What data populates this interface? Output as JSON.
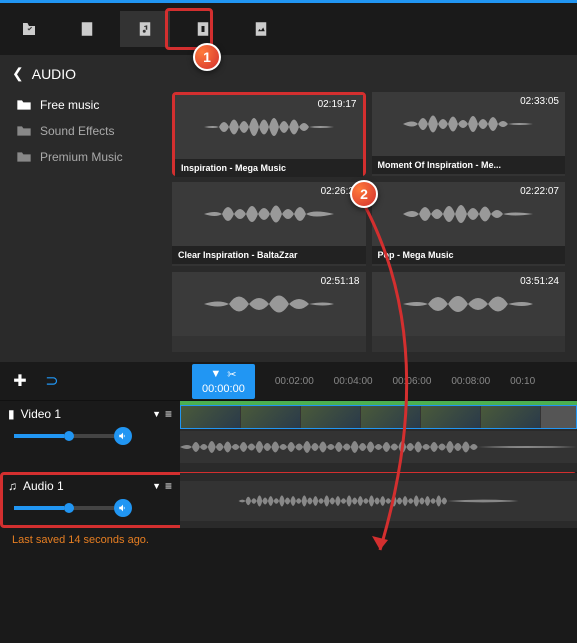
{
  "panel": {
    "title": "AUDIO",
    "categories": [
      {
        "label": "Free music",
        "active": true
      },
      {
        "label": "Sound Effects",
        "active": false
      },
      {
        "label": "Premium Music",
        "active": false
      }
    ]
  },
  "audio_items": [
    {
      "time": "02:19:17",
      "title": "Inspiration - Mega Music"
    },
    {
      "time": "02:33:05",
      "title": "Moment Of Inspiration - Me..."
    },
    {
      "time": "02:26:23",
      "title": "Clear Inspiration - BaltaZzar"
    },
    {
      "time": "02:22:07",
      "title": "Pop - Mega Music"
    },
    {
      "time": "02:51:18",
      "title": ""
    },
    {
      "time": "03:51:24",
      "title": ""
    }
  ],
  "timeline": {
    "playhead_time": "00:00:00",
    "marks": [
      "00:02:00",
      "00:04:00",
      "00:06:00",
      "00:08:00",
      "00:10"
    ]
  },
  "tracks": {
    "video": {
      "name": "Video 1"
    },
    "audio": {
      "name": "Audio 1"
    }
  },
  "status": "Last saved 14 seconds ago.",
  "callouts": {
    "one": "1",
    "two": "2"
  }
}
